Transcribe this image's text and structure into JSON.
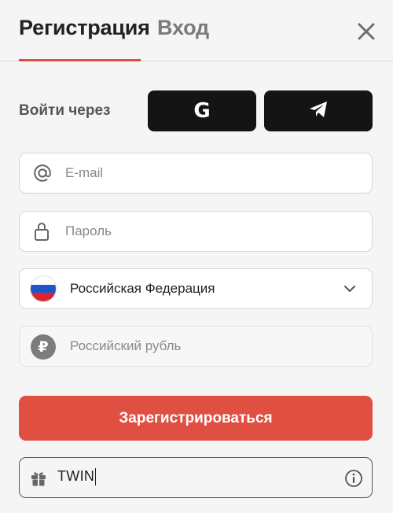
{
  "tabs": {
    "register": "Регистрация",
    "login": "Вход"
  },
  "social": {
    "label": "Войти через",
    "google_letter": "G"
  },
  "form": {
    "email_placeholder": "E-mail",
    "password_placeholder": "Пароль",
    "country_value": "Российская Федерация",
    "currency_value": "Российский рубль",
    "currency_symbol": "₽",
    "submit_label": "Зарегистрироваться",
    "promo_value": "TWIN"
  },
  "icons": {
    "close": "close-icon",
    "google": "google-icon",
    "telegram": "telegram-icon",
    "email": "at-sign-icon",
    "password": "lock-icon",
    "country": "russia-flag-icon",
    "dropdown": "chevron-down-icon",
    "currency": "ruble-icon",
    "promo": "gift-icon",
    "info": "info-icon"
  },
  "colors": {
    "accent": "#e04b3f",
    "submit": "#df5043",
    "social_bg": "#141414",
    "background": "#f5f5f5"
  }
}
